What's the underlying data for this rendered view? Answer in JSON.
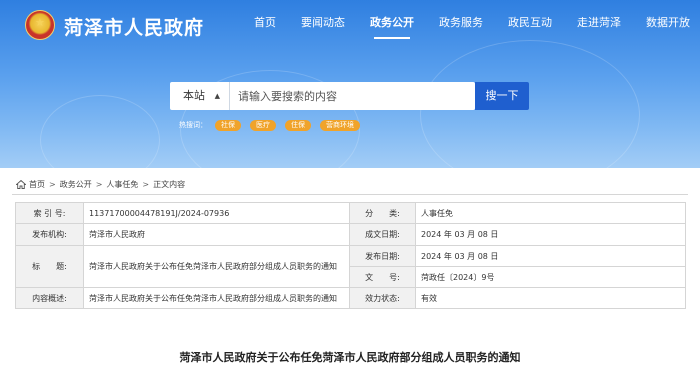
{
  "header": {
    "site_title": "菏泽市人民政府",
    "emblem_icon": "national-emblem-icon"
  },
  "nav": {
    "items": [
      {
        "label": "首页"
      },
      {
        "label": "要闻动态"
      },
      {
        "label": "政务公开",
        "active": true
      },
      {
        "label": "政务服务"
      },
      {
        "label": "政民互动"
      },
      {
        "label": "走进菏泽"
      },
      {
        "label": "数据开放"
      }
    ]
  },
  "search": {
    "scope_label": "本站",
    "scope_caret_icon": "caret-updown-icon",
    "placeholder": "请输入要搜索的内容",
    "button_label": "搜一下"
  },
  "hot_words": {
    "label": "热搜词：",
    "tags": [
      "社保",
      "医疗",
      "住保",
      "营商环境"
    ]
  },
  "breadcrumb": {
    "home_icon": "home-icon",
    "items": [
      "首页",
      "政务公开",
      "人事任免"
    ],
    "separator": ">",
    "current": "正文内容"
  },
  "meta": {
    "index_no": {
      "label": "索 引 号:",
      "value": "11371700004478191J/2024-07936"
    },
    "category": {
      "label": "分　　类:",
      "value": "人事任免"
    },
    "publisher": {
      "label": "发布机构:",
      "value": "菏泽市人民政府"
    },
    "written_date": {
      "label": "成文日期:",
      "value": "2024 年 03 月 08 日"
    },
    "title": {
      "label": "标　　题:",
      "value": "菏泽市人民政府关于公布任免菏泽市人民政府部分组成人员职务的通知"
    },
    "publish_date": {
      "label": "发布日期:",
      "value": "2024 年 03 月 08 日"
    },
    "doc_no": {
      "label": "文　　号:",
      "value": "菏政任〔2024〕9号"
    },
    "summary": {
      "label": "内容概述:",
      "value": "菏泽市人民政府关于公布任免菏泽市人民政府部分组成人员职务的通知"
    },
    "validity": {
      "label": "效力状态:",
      "value": "有效"
    }
  },
  "document": {
    "title": "菏泽市人民政府关于公布任免菏泽市人民政府部分组成人员职务的通知"
  },
  "colors": {
    "hero_top": "#2f7fe0",
    "search_button": "#1f5fcf",
    "hot_tag": "#f0a32a",
    "label_cell_bg": "#f1f1f1"
  }
}
